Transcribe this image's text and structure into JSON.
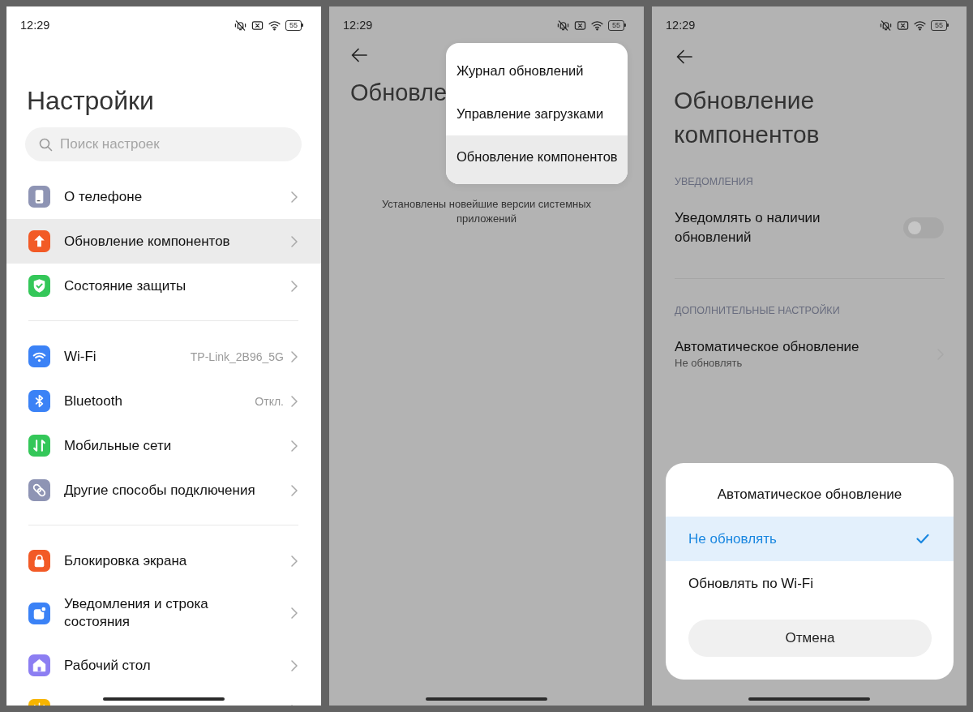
{
  "settings_screen": {
    "dimmed": false,
    "status_bar": {
      "time": "12:29",
      "battery": "55"
    },
    "title": "Настройки",
    "search": {
      "placeholder": "Поиск настроек"
    },
    "groups": [
      {
        "items": [
          {
            "label": "О телефоне",
            "color": "#8e94b4",
            "selected": false
          },
          {
            "label": "Обновление компонентов",
            "color": "#f25a26",
            "selected": true
          },
          {
            "label": "Состояние защиты",
            "color": "#34c759",
            "selected": false
          }
        ]
      },
      {
        "items": [
          {
            "label": "Wi-Fi",
            "value": "TP-Link_2B96_5G",
            "color": "#3b82f6",
            "selected": false
          },
          {
            "label": "Bluetooth",
            "value": "Откл.",
            "color": "#3b82f6",
            "selected": false
          },
          {
            "label": "Мобильные сети",
            "color": "#34c759",
            "selected": false
          },
          {
            "label": "Другие способы подключения",
            "color": "#8e94b4",
            "selected": false
          }
        ]
      },
      {
        "items": [
          {
            "label": "Блокировка экрана",
            "color": "#f25a26",
            "selected": false
          },
          {
            "label": "Уведомления и строка состояния",
            "color": "#3b82f6",
            "selected": false
          },
          {
            "label": "Рабочий стол",
            "color": "#8c7ef2",
            "selected": false
          },
          {
            "color": "#f7b500",
            "selected": false
          }
        ]
      }
    ]
  },
  "update_menu_screen": {
    "dimmed": true,
    "status_bar": {
      "time": "12:29",
      "battery": "55"
    },
    "title": "Обновле",
    "message": "Установлены новейшие версии системных приложений",
    "menu": [
      {
        "label": "Журнал обновлений",
        "selected": false
      },
      {
        "label": "Управление загрузками",
        "selected": false
      },
      {
        "label": "Обновление компонентов",
        "selected": true
      }
    ]
  },
  "component_update_screen": {
    "dimmed": true,
    "status_bar": {
      "time": "12:29",
      "battery": "55"
    },
    "title": "Обновление компонентов",
    "sections": [
      {
        "header": "УВЕДОМЛЕНИЯ",
        "rows": [
          {
            "kind": "toggle",
            "label": "Уведомлять о наличии обновлений",
            "on": false
          }
        ]
      },
      {
        "header": "ДОПОЛНИТЕЛЬНЫЕ НАСТРОЙКИ",
        "rows": [
          {
            "kind": "link",
            "label": "Автоматическое обновление",
            "value": "Не обновлять"
          }
        ]
      }
    ],
    "dialog": {
      "title": "Автоматическое обновление",
      "options": [
        {
          "label": "Не обновлять",
          "selected": true
        },
        {
          "label": "Обновлять по Wi-Fi",
          "selected": false
        }
      ],
      "cancel": "Отмена"
    }
  }
}
